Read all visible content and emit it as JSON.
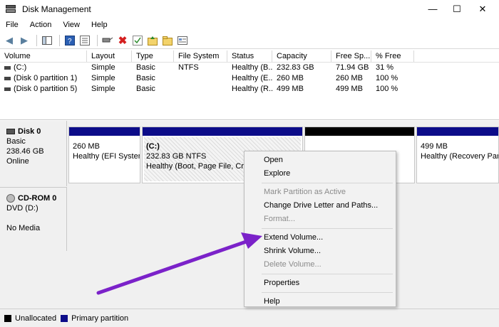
{
  "window": {
    "title": "Disk Management",
    "minimize": "—",
    "maximize": "☐",
    "close": "✕"
  },
  "menu": [
    "File",
    "Action",
    "View",
    "Help"
  ],
  "volume_list": {
    "headers": [
      "Volume",
      "Layout",
      "Type",
      "File System",
      "Status",
      "Capacity",
      "Free Sp...",
      "% Free"
    ],
    "rows": [
      [
        "(C:)",
        "Simple",
        "Basic",
        "NTFS",
        "Healthy (B...",
        "232.83 GB",
        "71.94 GB",
        "31 %"
      ],
      [
        "(Disk 0 partition 1)",
        "Simple",
        "Basic",
        "",
        "Healthy (E...",
        "260 MB",
        "260 MB",
        "100 %"
      ],
      [
        "(Disk 0 partition 5)",
        "Simple",
        "Basic",
        "",
        "Healthy (R...",
        "499 MB",
        "499 MB",
        "100 %"
      ]
    ]
  },
  "disk0": {
    "name": "Disk 0",
    "type": "Basic",
    "size": "238.46 GB",
    "status": "Online",
    "partitions": [
      {
        "size": "260 MB",
        "status": "Healthy (EFI System"
      },
      {
        "name": "(C:)",
        "size": "232.83 GB NTFS",
        "status": "Healthy (Boot, Page File, Crash"
      },
      {
        "size": "499 MB",
        "status": "Healthy (Recovery Part"
      }
    ]
  },
  "cdrom0": {
    "name": "CD-ROM 0",
    "type": "DVD (D:)",
    "status": "No Media"
  },
  "legend": {
    "unallocated": "Unallocated",
    "primary": "Primary partition",
    "unallocated_color": "#000000",
    "primary_color": "#0c0c89"
  },
  "context_menu": {
    "open": "Open",
    "explore": "Explore",
    "mark_active": "Mark Partition as Active",
    "change_letter": "Change Drive Letter and Paths...",
    "format": "Format...",
    "extend": "Extend Volume...",
    "shrink": "Shrink Volume...",
    "delete": "Delete Volume...",
    "properties": "Properties",
    "help": "Help"
  },
  "annotation_color": "#7b22c9"
}
